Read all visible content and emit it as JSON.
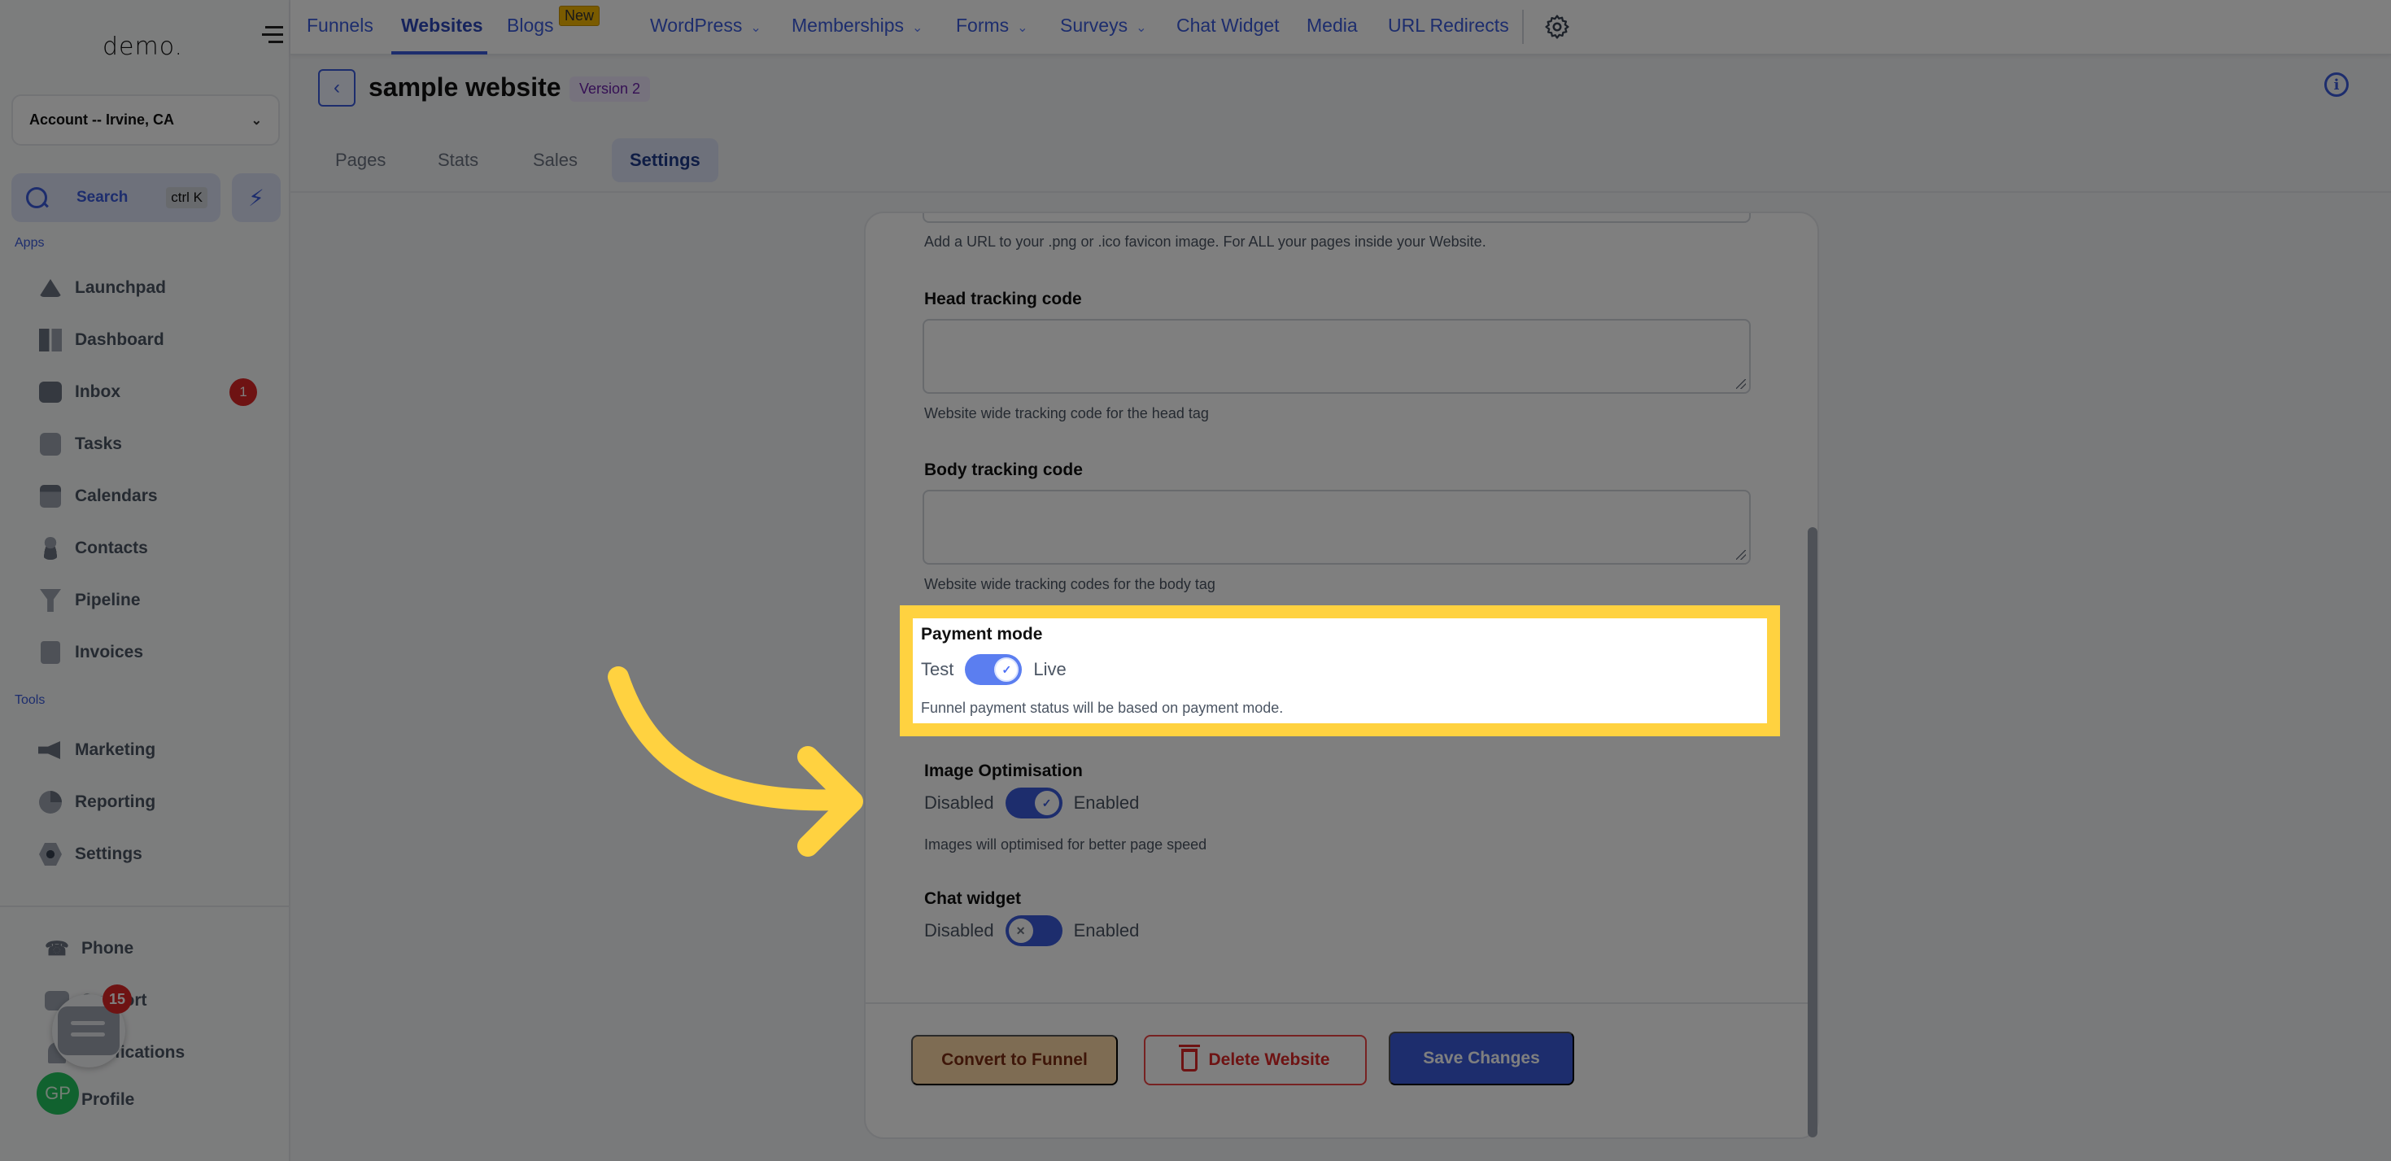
{
  "sidebar": {
    "logo": "demo.",
    "account": "Account -- Irvine, CA",
    "search": {
      "label": "Search",
      "shortcut": "ctrl K"
    },
    "apps_label": "Apps",
    "apps": [
      {
        "label": "Launchpad",
        "icon": "launchpad-icon"
      },
      {
        "label": "Dashboard",
        "icon": "dashboard-icon"
      },
      {
        "label": "Inbox",
        "icon": "inbox-icon",
        "badge": "1"
      },
      {
        "label": "Tasks",
        "icon": "tasks-icon"
      },
      {
        "label": "Calendars",
        "icon": "calendar-icon"
      },
      {
        "label": "Contacts",
        "icon": "contacts-icon"
      },
      {
        "label": "Pipeline",
        "icon": "pipeline-icon"
      },
      {
        "label": "Invoices",
        "icon": "invoices-icon"
      }
    ],
    "tools_label": "Tools",
    "tools": [
      {
        "label": "Marketing",
        "icon": "megaphone-icon"
      },
      {
        "label": "Reporting",
        "icon": "pie-chart-icon"
      },
      {
        "label": "Settings",
        "icon": "settings-icon"
      }
    ],
    "bottom": [
      {
        "label": "Phone",
        "icon": "phone-icon"
      },
      {
        "label": "Support",
        "icon": "support-icon"
      },
      {
        "label": "Notifications",
        "icon": "bell-icon"
      },
      {
        "label": "Profile",
        "icon": "avatar"
      }
    ],
    "avatar_initials": "GP",
    "chat_fab_count": "15"
  },
  "topnav": {
    "items": [
      {
        "label": "Funnels"
      },
      {
        "label": "Websites",
        "active": true
      },
      {
        "label": "Blogs",
        "badge": "New"
      },
      {
        "label": "WordPress",
        "dropdown": true
      },
      {
        "label": "Memberships",
        "dropdown": true
      },
      {
        "label": "Forms",
        "dropdown": true
      },
      {
        "label": "Surveys",
        "dropdown": true
      },
      {
        "label": "Chat Widget"
      },
      {
        "label": "Media"
      },
      {
        "label": "URL Redirects"
      }
    ],
    "settings_icon": "gear-icon"
  },
  "page": {
    "title": "sample website",
    "version_badge": "Version 2",
    "tabs": [
      "Pages",
      "Stats",
      "Sales",
      "Settings"
    ],
    "active_tab": "Settings"
  },
  "settings": {
    "favicon_help": "Add a URL to your .png or .ico favicon image. For ALL your pages inside your Website.",
    "head_tracking": {
      "label": "Head tracking code",
      "value": "",
      "help": "Website wide tracking code for the head tag"
    },
    "body_tracking": {
      "label": "Body tracking code",
      "value": "",
      "help": "Website wide tracking codes for the body tag"
    },
    "payment_mode": {
      "label": "Payment mode",
      "off_label": "Test",
      "on_label": "Live",
      "enabled": true,
      "help": "Funnel payment status will be based on payment mode."
    },
    "image_optimisation": {
      "label": "Image Optimisation",
      "off_label": "Disabled",
      "on_label": "Enabled",
      "enabled": true,
      "help": "Images will optimised for better page speed"
    },
    "chat_widget": {
      "label": "Chat widget",
      "off_label": "Disabled",
      "on_label": "Enabled",
      "enabled": false
    },
    "buttons": {
      "convert": "Convert to Funnel",
      "delete": "Delete Website",
      "save": "Save Changes"
    }
  },
  "colors": {
    "accent": "#3b5bdb",
    "highlight": "#ffd240",
    "danger": "#dc2626",
    "convert_bg": "#fcd9a6"
  }
}
